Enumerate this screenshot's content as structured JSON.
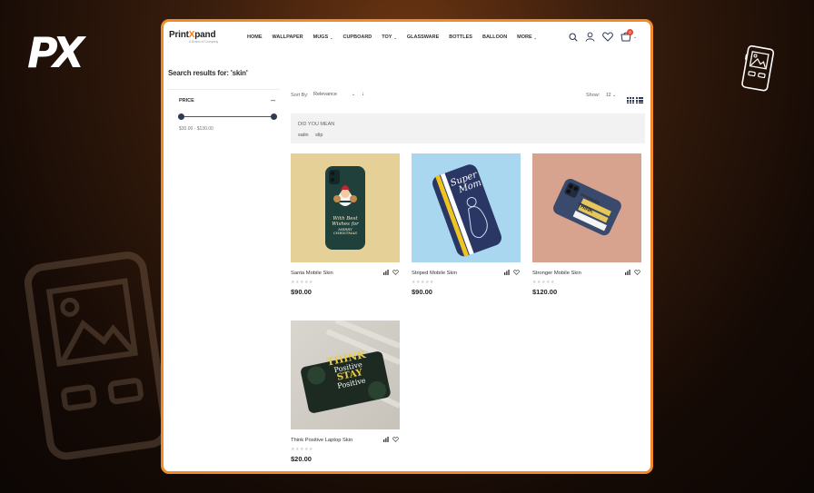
{
  "brand": {
    "overlay_logo": "PX",
    "name_a": "Print",
    "name_x": "X",
    "name_b": "pand",
    "tagline": "A Brand of Company"
  },
  "nav": {
    "items": [
      {
        "label": "HOME",
        "has_dropdown": false
      },
      {
        "label": "WALLPAPER",
        "has_dropdown": false
      },
      {
        "label": "MUGS",
        "has_dropdown": true
      },
      {
        "label": "CUPBOARD",
        "has_dropdown": false
      },
      {
        "label": "TOY",
        "has_dropdown": true
      },
      {
        "label": "GLASSWARE",
        "has_dropdown": false
      },
      {
        "label": "BOTTLES",
        "has_dropdown": false
      },
      {
        "label": "BALLOON",
        "has_dropdown": false
      },
      {
        "label": "MORE",
        "has_dropdown": true
      }
    ],
    "icons": [
      "search-icon",
      "user-icon",
      "heart-icon",
      "cart-icon"
    ],
    "cart_count": "0"
  },
  "search": {
    "title": "Search results for: 'skin'"
  },
  "filter": {
    "heading": "PRICE",
    "toggle": "–",
    "range_text": "$30.00 - $130.00",
    "min": 30,
    "max": 130
  },
  "toolbar": {
    "sort_label": "Sort By:",
    "sort_value": "Relevance",
    "show_label": "Show:",
    "show_value": "12"
  },
  "did_you_mean": {
    "title": "DID YOU MEAN",
    "suggestions": [
      "satin",
      "slip"
    ]
  },
  "products": [
    {
      "name": "Santa Mobile Skin",
      "price": "$90.00",
      "rating": "★★★★★"
    },
    {
      "name": "Striped Mobile Skin",
      "price": "$90.00",
      "rating": "★★★★★"
    },
    {
      "name": "Stronger Mobile Skin",
      "price": "$120.00",
      "rating": "★★★★★"
    },
    {
      "name": "Think Positive Laptop Skin",
      "price": "$20.00",
      "rating": "★★★★★"
    }
  ],
  "product_art": {
    "santa": {
      "line1": "With Best",
      "line2": "Wishes for",
      "line3": "MERRY",
      "line4": "CHRISTMAS"
    },
    "striped": {
      "line1": "Super",
      "line2": "Mom"
    },
    "stronger": {
      "line1": "STRONGER",
      "line2": "THINK"
    },
    "think": {
      "line1": "THINK",
      "line2": "Positive",
      "line3": "STAY",
      "line4": "Positive"
    }
  },
  "colors": {
    "accent": "#f08a2a",
    "slider": "#2f3b55",
    "badge": "#e8452c"
  }
}
